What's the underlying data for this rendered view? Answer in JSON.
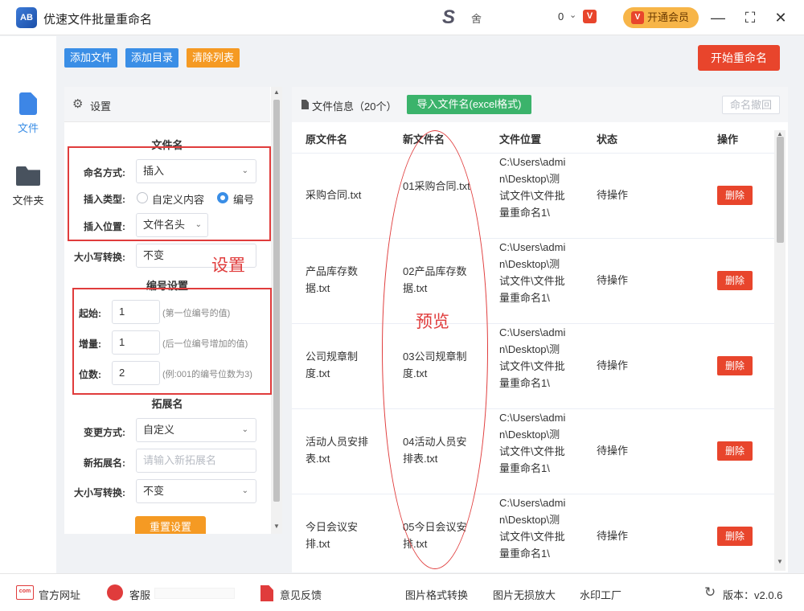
{
  "app": {
    "title": "优速文件批量重命名",
    "logo_text": "AB",
    "user_name": "舍",
    "coin_count": "0",
    "vip_button": "开通会员",
    "vip_icon_text": "V",
    "s_logo": "S"
  },
  "window_controls": {
    "minimize": "—",
    "maximize": "⛶",
    "close": "✕"
  },
  "rail": {
    "items": [
      {
        "label": "文件"
      },
      {
        "label": "文件夹"
      }
    ]
  },
  "toolbar": {
    "add_file": "添加文件",
    "add_dir": "添加目录",
    "clear_list": "清除列表",
    "start": "开始重命名"
  },
  "settings": {
    "title": "设置",
    "section_filename": "文件名",
    "naming_mode_label": "命名方式:",
    "naming_mode_value": "插入",
    "insert_type_label": "插入类型:",
    "insert_type_options": [
      "自定义内容",
      "编号"
    ],
    "insert_type_selected": "编号",
    "insert_pos_label": "插入位置:",
    "insert_pos_value": "文件名头",
    "case_label": "大小写转换:",
    "case_value": "不变",
    "section_numbering": "编号设置",
    "start_label": "起始:",
    "start_value": "1",
    "start_hint": "(第一位编号的值)",
    "step_label": "增量:",
    "step_value": "1",
    "step_hint": "(后一位编号增加的值)",
    "digits_label": "位数:",
    "digits_value": "2",
    "digits_hint": "(例:001的编号位数为3)",
    "section_ext": "拓展名",
    "ext_mode_label": "变更方式:",
    "ext_mode_value": "自定义",
    "new_ext_label": "新拓展名:",
    "new_ext_placeholder": "请输入新拓展名",
    "ext_case_label": "大小写转换:",
    "ext_case_value": "不变",
    "reset_button": "重置设置"
  },
  "annotations": {
    "settings_note": "设置",
    "preview_note": "预览",
    "highlight_color": "#e03c3c"
  },
  "files": {
    "title": "文件信息（20个）",
    "import_button": "导入文件名(excel格式)",
    "undo_button": "命名撤回",
    "columns": [
      "原文件名",
      "新文件名",
      "文件位置",
      "状态",
      "操作"
    ],
    "rows": [
      {
        "original": "采购合同.txt",
        "new": "01采购合同.txt",
        "location": "C:\\Users\\admin\\Desktop\\测试文件\\文件批量重命名1\\",
        "status": "待操作",
        "action": "删除"
      },
      {
        "original": "产品库存数据.txt",
        "new": "02产品库存数据.txt",
        "location": "C:\\Users\\admin\\Desktop\\测试文件\\文件批量重命名1\\",
        "status": "待操作",
        "action": "删除"
      },
      {
        "original": "公司规章制度.txt",
        "new": "03公司规章制度.txt",
        "location": "C:\\Users\\admin\\Desktop\\测试文件\\文件批量重命名1\\",
        "status": "待操作",
        "action": "删除"
      },
      {
        "original": "活动人员安排表.txt",
        "new": "04活动人员安排表.txt",
        "location": "C:\\Users\\admin\\Desktop\\测试文件\\文件批量重命名1\\",
        "status": "待操作",
        "action": "删除"
      },
      {
        "original": "今日会议安排.txt",
        "new": "05今日会议安排.txt",
        "location": "C:\\Users\\admin\\Desktop\\测试文件\\文件批量重命名1\\",
        "status": "待操作",
        "action": "删除"
      }
    ]
  },
  "footer": {
    "website": "官方网址",
    "service": "客服",
    "feedback": "意见反馈",
    "img_convert": "图片格式转换",
    "img_enlarge": "图片无损放大",
    "watermark": "水印工厂",
    "version": "版本：v2.0.6",
    "com_icon_text": "com"
  },
  "colors": {
    "primary_blue": "#3a8ee6",
    "orange": "#f59a23",
    "red": "#e8452c",
    "green": "#3bb36b"
  }
}
